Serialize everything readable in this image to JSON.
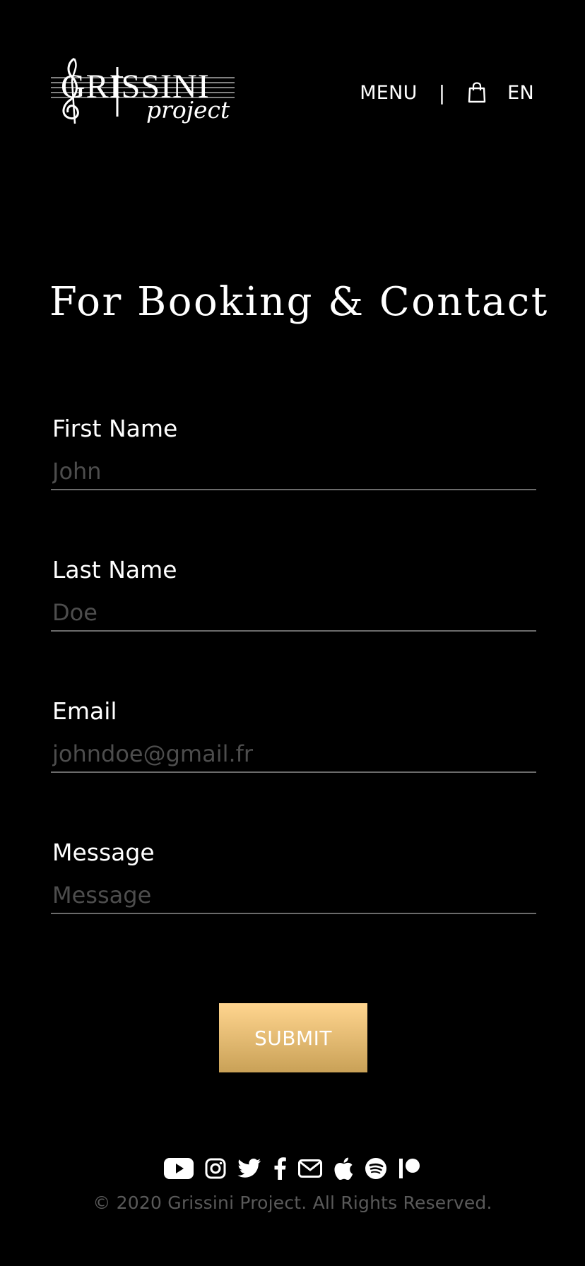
{
  "header": {
    "logo_text": "GRISSINI",
    "logo_subtext": "project",
    "menu_label": "MENU",
    "separator": "|",
    "cart_icon": "shopping-bag-icon",
    "language": "EN"
  },
  "main": {
    "title": "For Booking & Contact",
    "form": {
      "fields": [
        {
          "label": "First Name",
          "placeholder": "John",
          "value": ""
        },
        {
          "label": "Last Name",
          "placeholder": "Doe",
          "value": ""
        },
        {
          "label": "Email",
          "placeholder": "johndoe@gmail.fr",
          "value": ""
        },
        {
          "label": "Message",
          "placeholder": "Message",
          "value": ""
        }
      ],
      "submit_label": "SUBMIT"
    }
  },
  "footer": {
    "social_icons": [
      "youtube-icon",
      "instagram-icon",
      "twitter-icon",
      "facebook-icon",
      "mail-icon",
      "apple-icon",
      "spotify-icon",
      "patreon-icon"
    ],
    "copyright": "© 2020 Grissini Project. All Rights Reserved."
  },
  "colors": {
    "background": "#000000",
    "text": "#ffffff",
    "placeholder": "#4d4d4d",
    "underline": "#6b6b6b",
    "button_gradient_top": "#ffd58f",
    "button_gradient_bottom": "#c9a157",
    "copyright": "#5a5a5a"
  }
}
